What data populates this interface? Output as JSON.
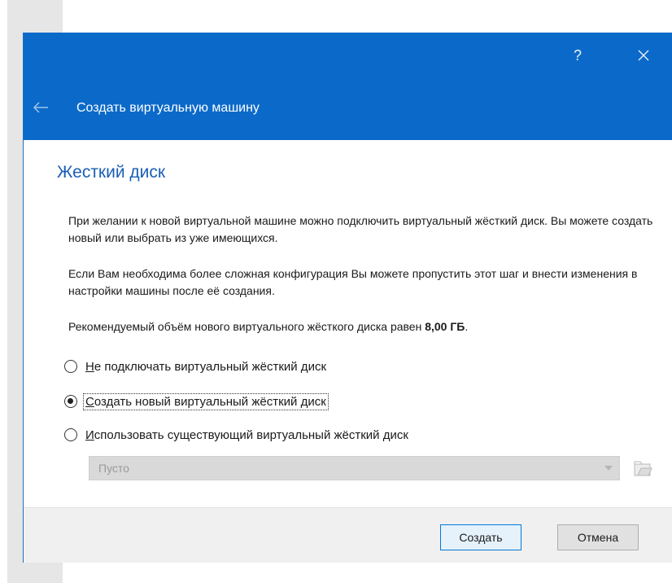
{
  "dialog": {
    "title": "Создать виртуальную машину",
    "help_label": "?",
    "icons": {
      "back": "back-arrow-icon",
      "close": "close-icon",
      "folder": "folder-open-icon",
      "dropdown": "chevron-down-icon"
    },
    "colors": {
      "header": "#0b6ac9",
      "title_text": "#1a5fb4",
      "default_button_border": "#0078d7"
    }
  },
  "page": {
    "title": "Жесткий диск",
    "paragraph1": "При желании к новой виртуальной машине можно подключить виртуальный жёсткий диск. Вы можете создать новый или выбрать из уже имеющихся.",
    "paragraph2": "Если Вам необходима более сложная конфигурация Вы можете пропустить этот шаг и внести изменения в настройки машины после её создания.",
    "recommended_prefix": "Рекомендуемый объём нового виртуального жёсткого диска равен ",
    "recommended_size": "8,00 ГБ",
    "recommended_suffix": "."
  },
  "options": [
    {
      "mnemonic": "Н",
      "rest": "е подключать виртуальный жёсткий диск",
      "checked": false
    },
    {
      "mnemonic": "С",
      "rest": "оздать новый виртуальный жёсткий диск",
      "checked": true
    },
    {
      "mnemonic": "И",
      "rest": "спользовать существующий виртуальный жёсткий диск",
      "checked": false
    }
  ],
  "disk_select": {
    "value": "Пусто",
    "enabled": false
  },
  "buttons": {
    "create": "Создать",
    "cancel": "Отмена"
  }
}
